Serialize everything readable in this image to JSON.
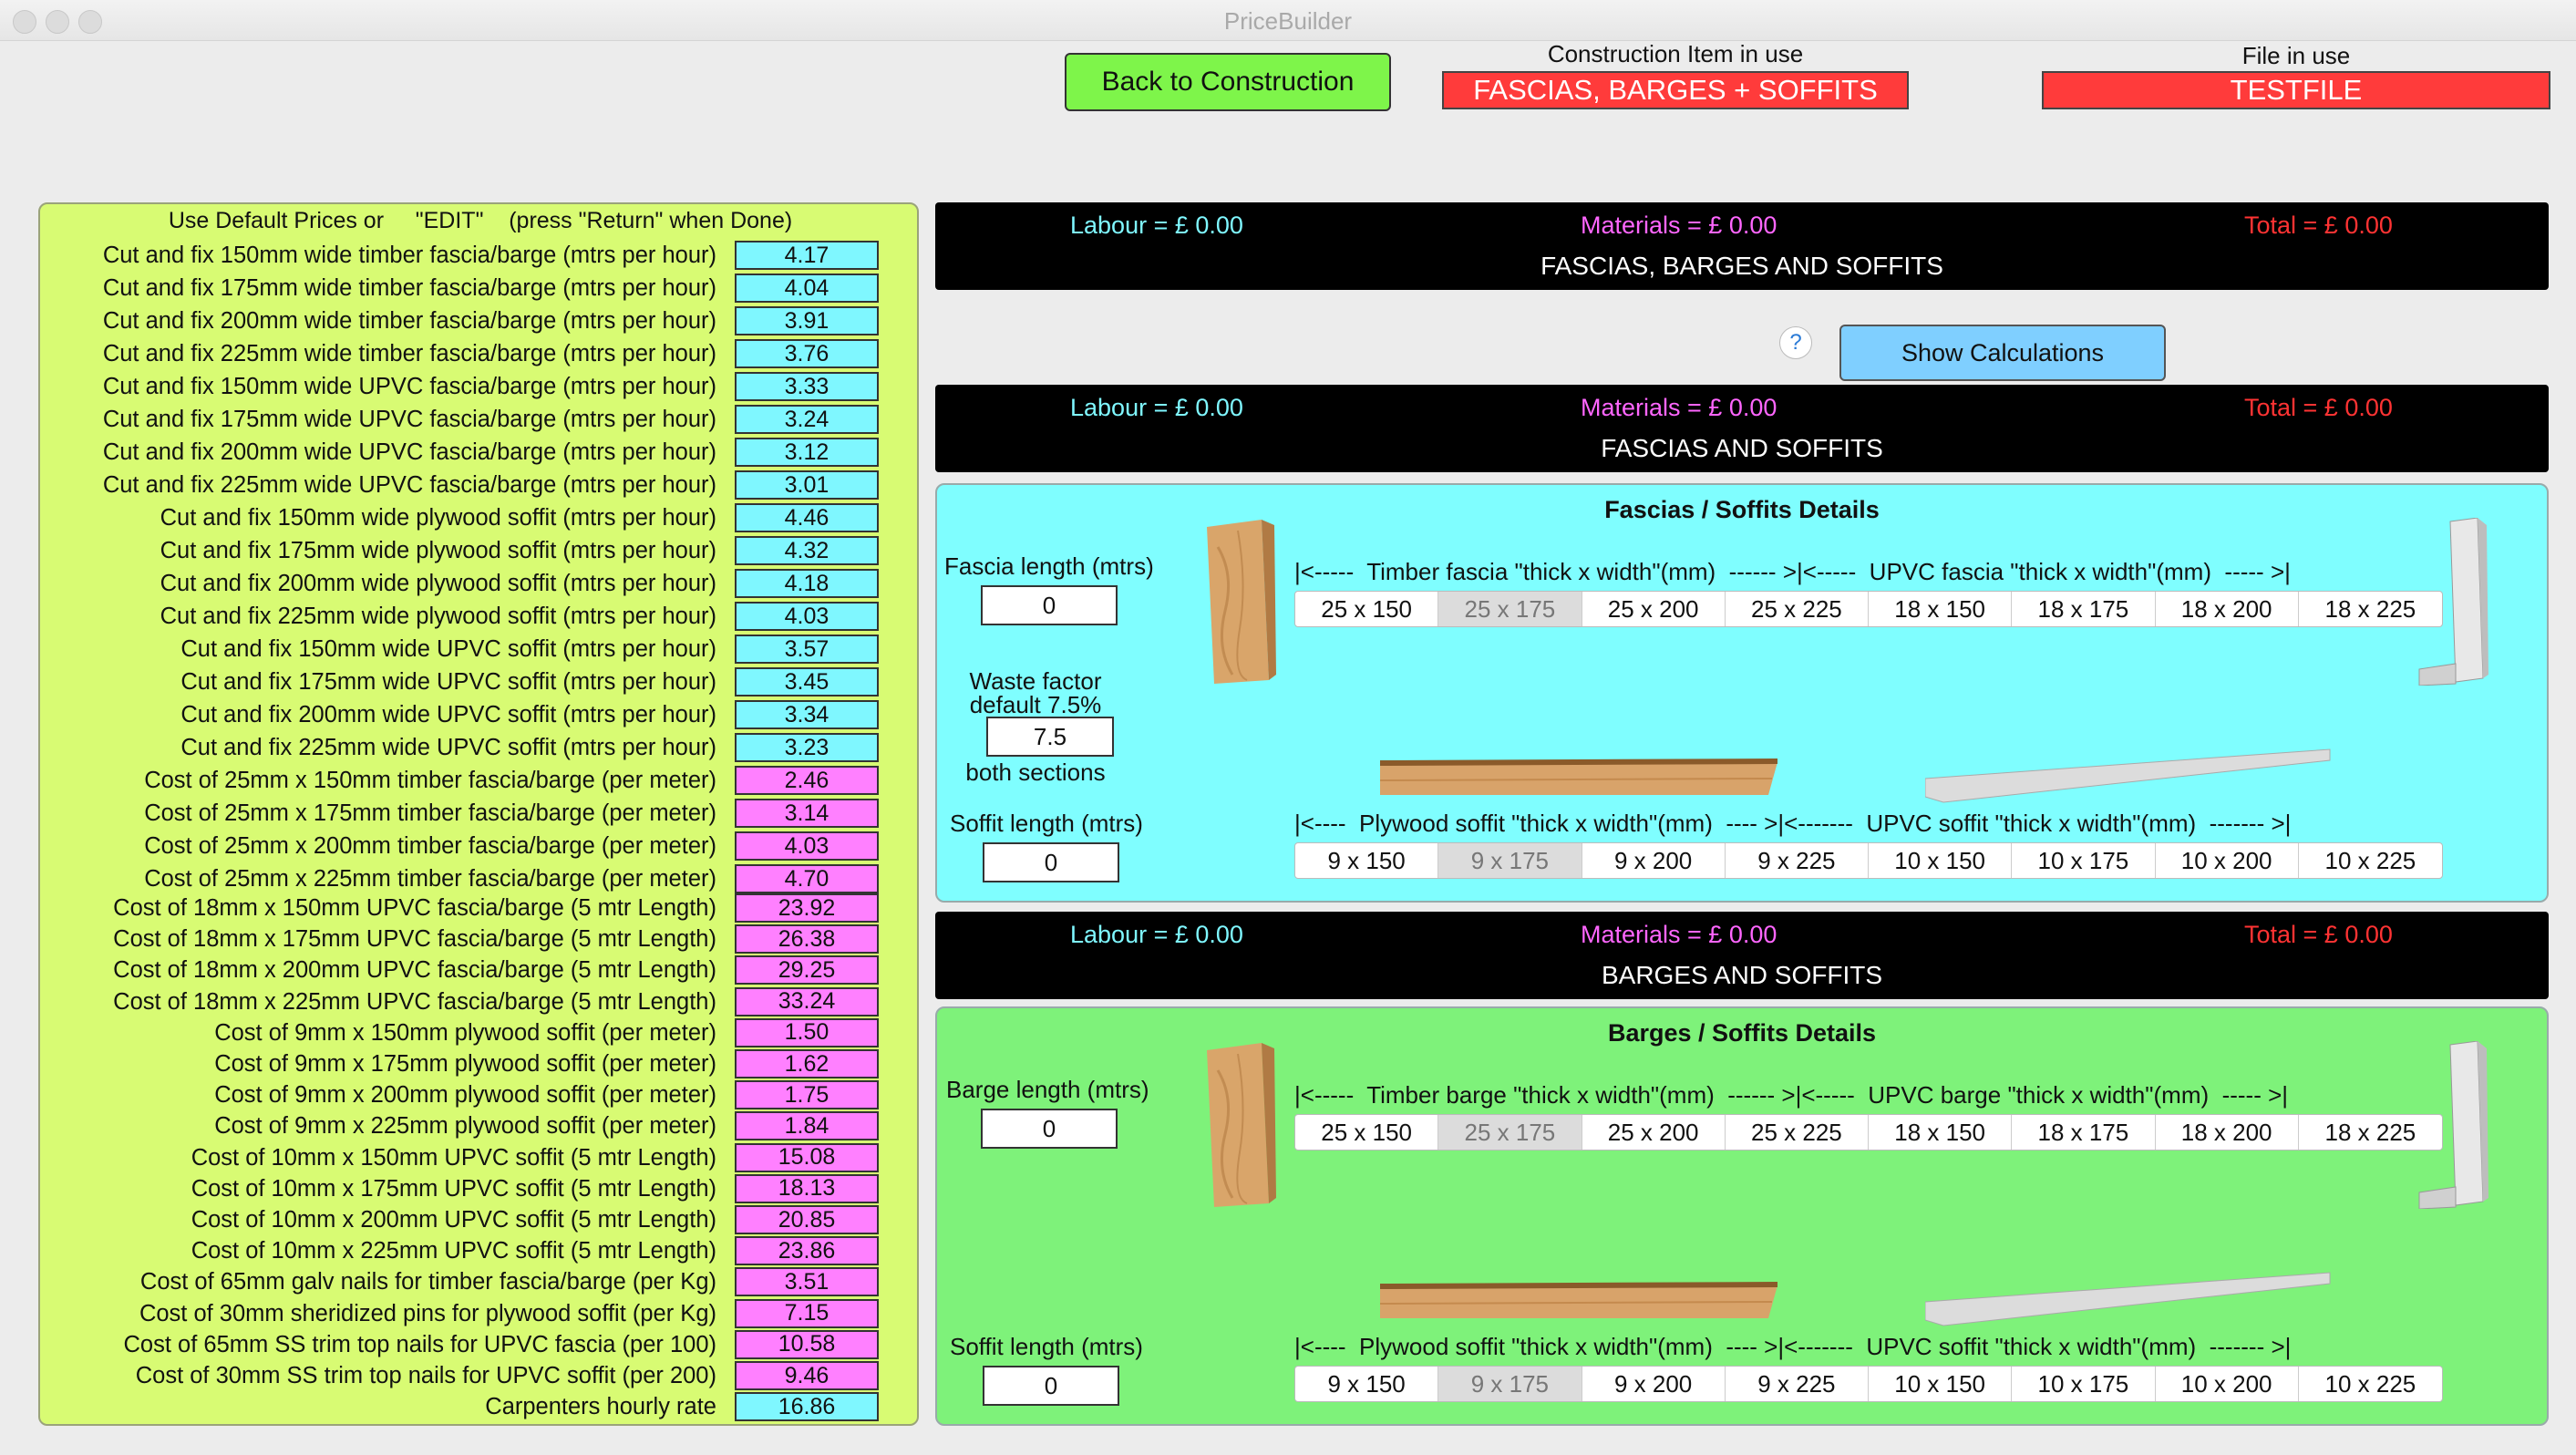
{
  "window": {
    "title": "PriceBuilder"
  },
  "header": {
    "back_button": "Back to Construction",
    "construction_label": "Construction Item in use",
    "construction_value": "FASCIAS, BARGES + SOFFITS",
    "file_label": "File in use",
    "file_value": "TESTFILE"
  },
  "left_panel": {
    "header": "Use Default Prices or     \"EDIT\"    (press \"Return\" when Done)",
    "rows": [
      {
        "label": "Cut and fix 150mm wide timber fascia/barge (mtrs per hour)",
        "value": "4.17"
      },
      {
        "label": "Cut and fix 175mm wide timber fascia/barge (mtrs per hour)",
        "value": "4.04"
      },
      {
        "label": "Cut and fix 200mm wide timber fascia/barge (mtrs per hour)",
        "value": "3.91"
      },
      {
        "label": "Cut and fix 225mm wide timber fascia/barge (mtrs per hour)",
        "value": "3.76"
      },
      {
        "label": "Cut and fix 150mm wide UPVC fascia/barge (mtrs per hour)",
        "value": "3.33"
      },
      {
        "label": "Cut and fix 175mm wide UPVC fascia/barge (mtrs per hour)",
        "value": "3.24"
      },
      {
        "label": "Cut and fix 200mm wide UPVC fascia/barge (mtrs per hour)",
        "value": "3.12"
      },
      {
        "label": "Cut and fix 225mm wide UPVC fascia/barge (mtrs per hour)",
        "value": "3.01"
      },
      {
        "label": "Cut and fix 150mm wide plywood soffit (mtrs per hour)",
        "value": "4.46"
      },
      {
        "label": "Cut and fix 175mm wide plywood soffit (mtrs per hour)",
        "value": "4.32"
      },
      {
        "label": "Cut and fix 200mm wide plywood soffit (mtrs per hour)",
        "value": "4.18"
      },
      {
        "label": "Cut and fix 225mm wide plywood soffit (mtrs per hour)",
        "value": "4.03"
      },
      {
        "label": "Cut and fix 150mm wide UPVC soffit (mtrs per hour)",
        "value": "3.57"
      },
      {
        "label": "Cut and fix 175mm wide UPVC soffit (mtrs per hour)",
        "value": "3.45"
      },
      {
        "label": "Cut and fix 200mm wide UPVC soffit (mtrs per hour)",
        "value": "3.34"
      },
      {
        "label": "Cut and fix 225mm wide UPVC soffit (mtrs per hour)",
        "value": "3.23"
      },
      {
        "label": "Cost of 25mm x 150mm timber fascia/barge (per meter)",
        "value": "2.46"
      },
      {
        "label": "Cost of 25mm x 175mm timber fascia/barge (per meter)",
        "value": "3.14"
      },
      {
        "label": "Cost of 25mm x 200mm timber fascia/barge (per meter)",
        "value": "4.03"
      },
      {
        "label": "Cost of 25mm x 225mm timber fascia/barge (per meter)",
        "value": "4.70"
      },
      {
        "label": "Cost of 18mm x 150mm UPVC fascia/barge (5 mtr Length)",
        "value": "23.92"
      },
      {
        "label": "Cost of 18mm x 175mm UPVC fascia/barge (5 mtr Length)",
        "value": "26.38"
      },
      {
        "label": "Cost of 18mm x 200mm UPVC fascia/barge (5 mtr Length)",
        "value": "29.25"
      },
      {
        "label": "Cost of 18mm x 225mm UPVC fascia/barge (5 mtr Length)",
        "value": "33.24"
      },
      {
        "label": "Cost of 9mm x 150mm plywood soffit (per meter)",
        "value": "1.50"
      },
      {
        "label": "Cost of 9mm x 175mm plywood soffit (per meter)",
        "value": "1.62"
      },
      {
        "label": "Cost of 9mm x 200mm plywood soffit (per meter)",
        "value": "1.75"
      },
      {
        "label": "Cost of 9mm x 225mm plywood soffit (per meter)",
        "value": "1.84"
      },
      {
        "label": "Cost of 10mm x 150mm UPVC soffit (5 mtr Length)",
        "value": "15.08"
      },
      {
        "label": "Cost of 10mm x 175mm UPVC soffit (5 mtr Length)",
        "value": "18.13"
      },
      {
        "label": "Cost of 10mm x 200mm UPVC soffit (5 mtr Length)",
        "value": "20.85"
      },
      {
        "label": "Cost of 10mm x 225mm UPVC soffit (5 mtr Length)",
        "value": "23.86"
      },
      {
        "label": "Cost of 65mm galv nails for timber fascia/barge (per Kg)",
        "value": "3.51"
      },
      {
        "label": "Cost of 30mm sheridized pins for plywood soffit (per Kg)",
        "value": "7.15"
      },
      {
        "label": "Cost of 65mm SS trim top nails for UPVC fascia (per 100)",
        "value": "10.58"
      },
      {
        "label": "Cost of 30mm SS trim top nails for UPVC soffit (per 200)",
        "value": "9.46"
      },
      {
        "label": "Carpenters hourly rate",
        "value": "16.86"
      }
    ]
  },
  "summary_all": {
    "labour": "Labour = £  0.00",
    "materials": "Materials = £  0.00",
    "total": "Total = £  0.00",
    "title": "FASCIAS, BARGES AND SOFFITS"
  },
  "help_icon": "?",
  "show_calc_button": "Show Calculations",
  "summary_fascia": {
    "labour": "Labour = £  0.00",
    "materials": "Materials = £  0.00",
    "total": "Total = £  0.00",
    "title": "FASCIAS AND SOFFITS"
  },
  "fascia_panel": {
    "title": "Fascias / Soffits Details",
    "length_label": "Fascia length (mtrs)",
    "length_value": "0",
    "waste_label_1": "Waste factor",
    "waste_label_2": "default 7.5%",
    "waste_value": "7.5",
    "waste_label_3": "both sections",
    "span_top": "|<-----  Timber fascia \"thick x width\"(mm)  ------ >|<-----  UPVC fascia \"thick x width\"(mm)  ----- >|",
    "top_options": [
      "25 x 150",
      "25 x 175",
      "25 x 200",
      "25 x 225",
      "18 x 150",
      "18 x 175",
      "18 x 200",
      "18 x 225"
    ],
    "top_selected": 1,
    "soffit_label": "Soffit length (mtrs)",
    "soffit_value": "0",
    "span_bottom": "|<----  Plywood soffit \"thick x width\"(mm)  ---- >|<-------  UPVC soffit \"thick x width\"(mm)  ------- >|",
    "bottom_options": [
      "9 x 150",
      "9 x 175",
      "9 x 200",
      "9 x 225",
      "10 x 150",
      "10 x 175",
      "10 x 200",
      "10 x 225"
    ],
    "bottom_selected": 1
  },
  "summary_barge": {
    "labour": "Labour = £  0.00",
    "materials": "Materials = £  0.00",
    "total": "Total = £  0.00",
    "title": "BARGES AND SOFFITS"
  },
  "barge_panel": {
    "title": "Barges / Soffits Details",
    "length_label": "Barge length (mtrs)",
    "length_value": "0",
    "span_top": "|<-----  Timber barge \"thick x width\"(mm)  ------ >|<-----  UPVC barge \"thick x width\"(mm)  ----- >|",
    "top_options": [
      "25 x 150",
      "25 x 175",
      "25 x 200",
      "25 x 225",
      "18 x 150",
      "18 x 175",
      "18 x 200",
      "18 x 225"
    ],
    "top_selected": 1,
    "soffit_label": "Soffit length (mtrs)",
    "soffit_value": "0",
    "span_bottom": "|<----  Plywood soffit \"thick x width\"(mm)  ---- >|<-------  UPVC soffit \"thick x width\"(mm)  ------- >|",
    "bottom_options": [
      "9 x 150",
      "9 x 175",
      "9 x 200",
      "9 x 225",
      "10 x 150",
      "10 x 175",
      "10 x 200",
      "10 x 225"
    ],
    "bottom_selected": 1
  },
  "colors": {
    "left_panel_bg": "#d8fb73",
    "labour_input": "#7ff7ff",
    "material_input": "#ff80ff",
    "fascia_panel_bg": "#7ffeff",
    "barge_panel_bg": "#7ef27a",
    "red_box": "#ff3b3b",
    "back_button": "#7ef54a",
    "calc_button": "#7fcfff"
  }
}
